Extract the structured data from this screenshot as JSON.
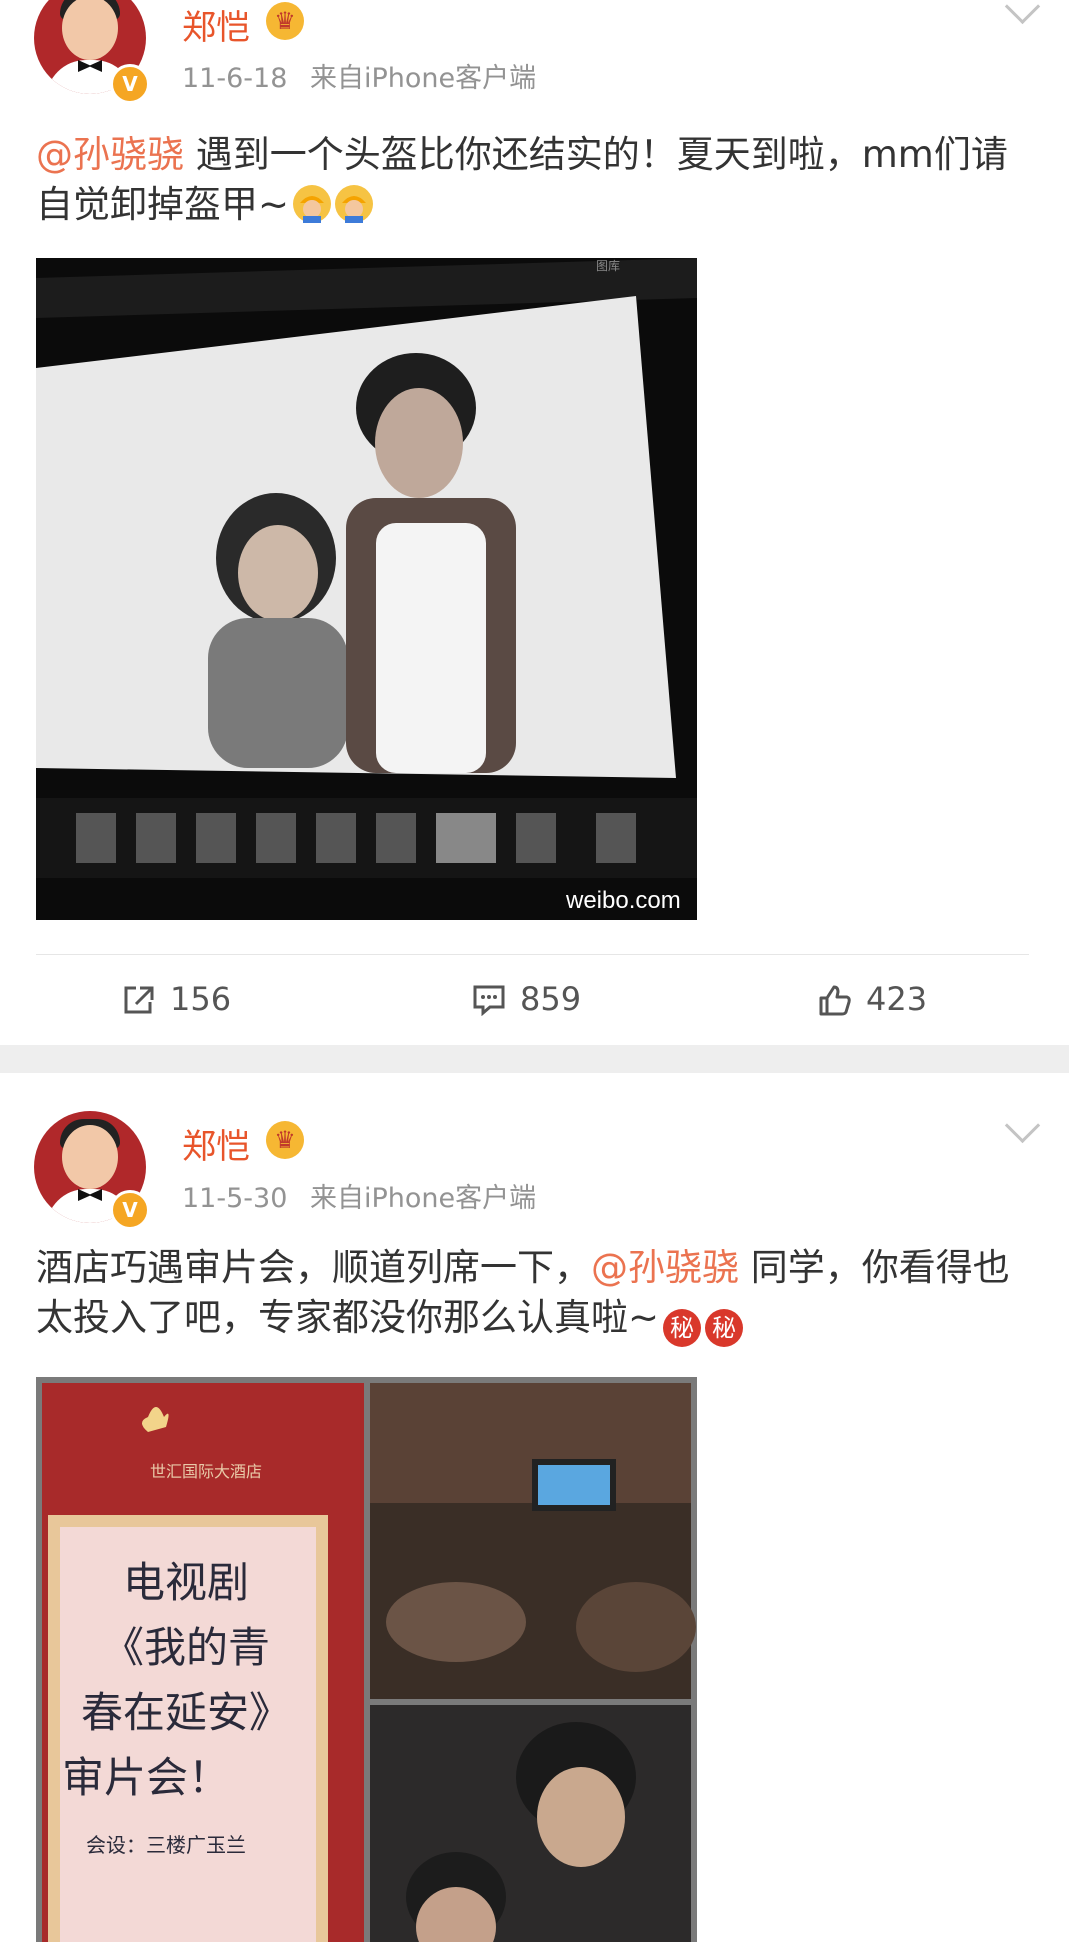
{
  "posts": [
    {
      "username": "郑恺",
      "timestamp": "11-6-18",
      "source": "来自iPhone客户端",
      "mention": "@孙骁骁",
      "text_after_mention": " 遇到一个头盔比你还结实的！夏天到啦，mm们请自觉卸掉盔甲~",
      "emojis": [
        "construction-worker-icon",
        "construction-worker-icon"
      ],
      "image_watermark": "weibo.com",
      "image_window_label": "图库",
      "actions": {
        "repost_count": "156",
        "comment_count": "859",
        "like_count": "423"
      }
    },
    {
      "username": "郑恺",
      "timestamp": "11-5-30",
      "source": "来自iPhone客户端",
      "text_before_mention": "酒店巧遇审片会，顺道列席一下，",
      "mention": "@孙骁骁",
      "text_after_mention": " 同学，你看得也太投入了吧，专家都没你那么认真啦~",
      "secret_emoji_label": "秘",
      "poster": {
        "hotel_name": "世汇国际大酒店",
        "line1": "电视剧",
        "line2": "《我的青",
        "line3": "春在延安》",
        "line4": "审片会！",
        "line5": "会设：三楼广玉兰"
      }
    }
  ],
  "colors": {
    "username": "#e8552b",
    "mention": "#eb7350",
    "meta": "#939393",
    "separator": "#eeeeee",
    "verified_badge": "#f5a623"
  }
}
